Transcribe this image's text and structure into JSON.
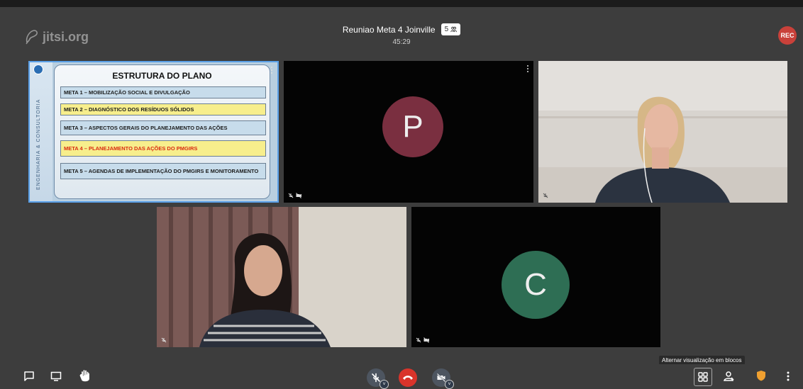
{
  "header": {
    "logo_text": "jitsi.org",
    "meeting_name": "Reuniao Meta 4 Joinville",
    "participant_count": "5",
    "timer": "45:29",
    "rec_label": "REC"
  },
  "tiles": {
    "slide": {
      "title": "ESTRUTURA DO PLANO",
      "side_text": "ENGENHARIA & CONSULTORIA",
      "metas": [
        "META 1 – MOBILIZAÇÃO SOCIAL E DIVULGAÇÃO",
        "META 2 – DIAGNÓSTICO DOS RESÍDUOS SÓLIDOS",
        "META 3 – ASPECTOS GERAIS DO PLANEJAMENTO DAS AÇÕES",
        "META 4 – PLANEJAMENTO DAS AÇÕES DO PMGIRS",
        "META 5 – AGENDAS DE IMPLEMENTAÇÃO DO PMGIRS E MONITORAMENTO"
      ]
    },
    "participant_p": {
      "initial": "P",
      "color": "#7a2f40"
    },
    "participant_c": {
      "initial": "C",
      "color": "#2e6e54"
    }
  },
  "toolbar": {
    "tooltip": "Alternar visualização em blocos",
    "icons": [
      "chat-icon",
      "screenshare-icon",
      "raise-hand-icon",
      "mic-muted-icon",
      "hangup-icon",
      "camera-off-icon",
      "tile-view-icon",
      "participants-icon",
      "security-icon",
      "more-icon"
    ]
  },
  "colors": {
    "background": "#3d3d3d",
    "rec": "#c9413a",
    "hangup": "#d9342b",
    "active_border": "#5aa0e8",
    "security": "#f0a030"
  }
}
